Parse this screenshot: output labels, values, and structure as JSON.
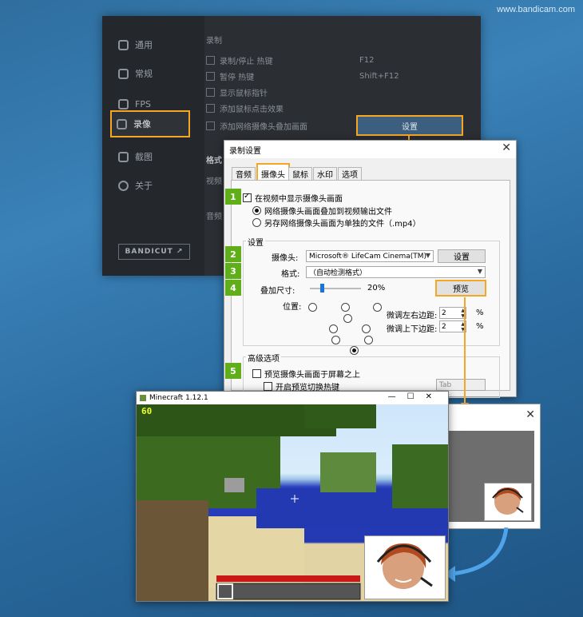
{
  "watermark": "www.bandicam.com",
  "bandicam": {
    "sidebar": [
      {
        "label": "通用"
      },
      {
        "label": "常规"
      },
      {
        "label": "FPS"
      },
      {
        "label": "录像"
      },
      {
        "label": "截图"
      },
      {
        "label": "关于"
      }
    ],
    "bandicut": "BANDICUT ↗",
    "section": "录制",
    "rows": [
      {
        "label": "录制/停止 热键",
        "value": "F12"
      },
      {
        "label": "暂停 热键",
        "value": "Shift+F12"
      },
      {
        "label": "显示鼠标指针",
        "value": ""
      },
      {
        "label": "添加鼠标点击效果",
        "value": ""
      },
      {
        "label": "添加网络摄像头叠加画面",
        "value": ""
      }
    ],
    "format_label": "格式",
    "video_label": "视频",
    "audio_label": "音频",
    "settings_button": "设置"
  },
  "dialog": {
    "title": "录制设置",
    "close": "✕",
    "tabs": [
      "音频",
      "摄像头",
      "鼠标",
      "水印",
      "选项"
    ],
    "selected_tab": "摄像头",
    "steps": [
      "1",
      "2",
      "3",
      "4",
      "5"
    ],
    "show_webcam": "在视频中显示摄像头画面",
    "radio_overlay": "网络摄像头画面叠加到视频输出文件",
    "radio_separate": "另存网络摄像头画面为单独的文件（.mp4）",
    "settings_group": "设置",
    "camera_label": "摄像头:",
    "camera_value": "Microsoft® LifeCam Cinema(TM)",
    "camera_settings_button": "设置",
    "format_label": "格式:",
    "format_value": "（自动检测格式）",
    "overlay_size_label": "叠加尺寸:",
    "overlay_size_value": "20%",
    "overlay_size": 0.2,
    "preview_button": "预览",
    "position_label": "位置:",
    "position_selected": "bottom-right",
    "h_margin_label": "微调左右边距:",
    "h_margin_value": "2",
    "v_margin_label": "微调上下边距:",
    "v_margin_value": "2",
    "percent": "%",
    "advanced_group": "高级选项",
    "preview_on_top": "预览摄像头画面于屏幕之上",
    "preview_hotkey": "开启预览切换热键",
    "hotkey_value": "Tab"
  },
  "minecraft": {
    "title": "Minecraft 1.12.1",
    "fps": "60",
    "controls": [
      "—",
      "☐",
      "✕"
    ]
  },
  "preview_window": {
    "close": "✕"
  },
  "colors": {
    "highlight": "#f5a623",
    "step": "#5fae1a",
    "water": "#2339b2"
  }
}
